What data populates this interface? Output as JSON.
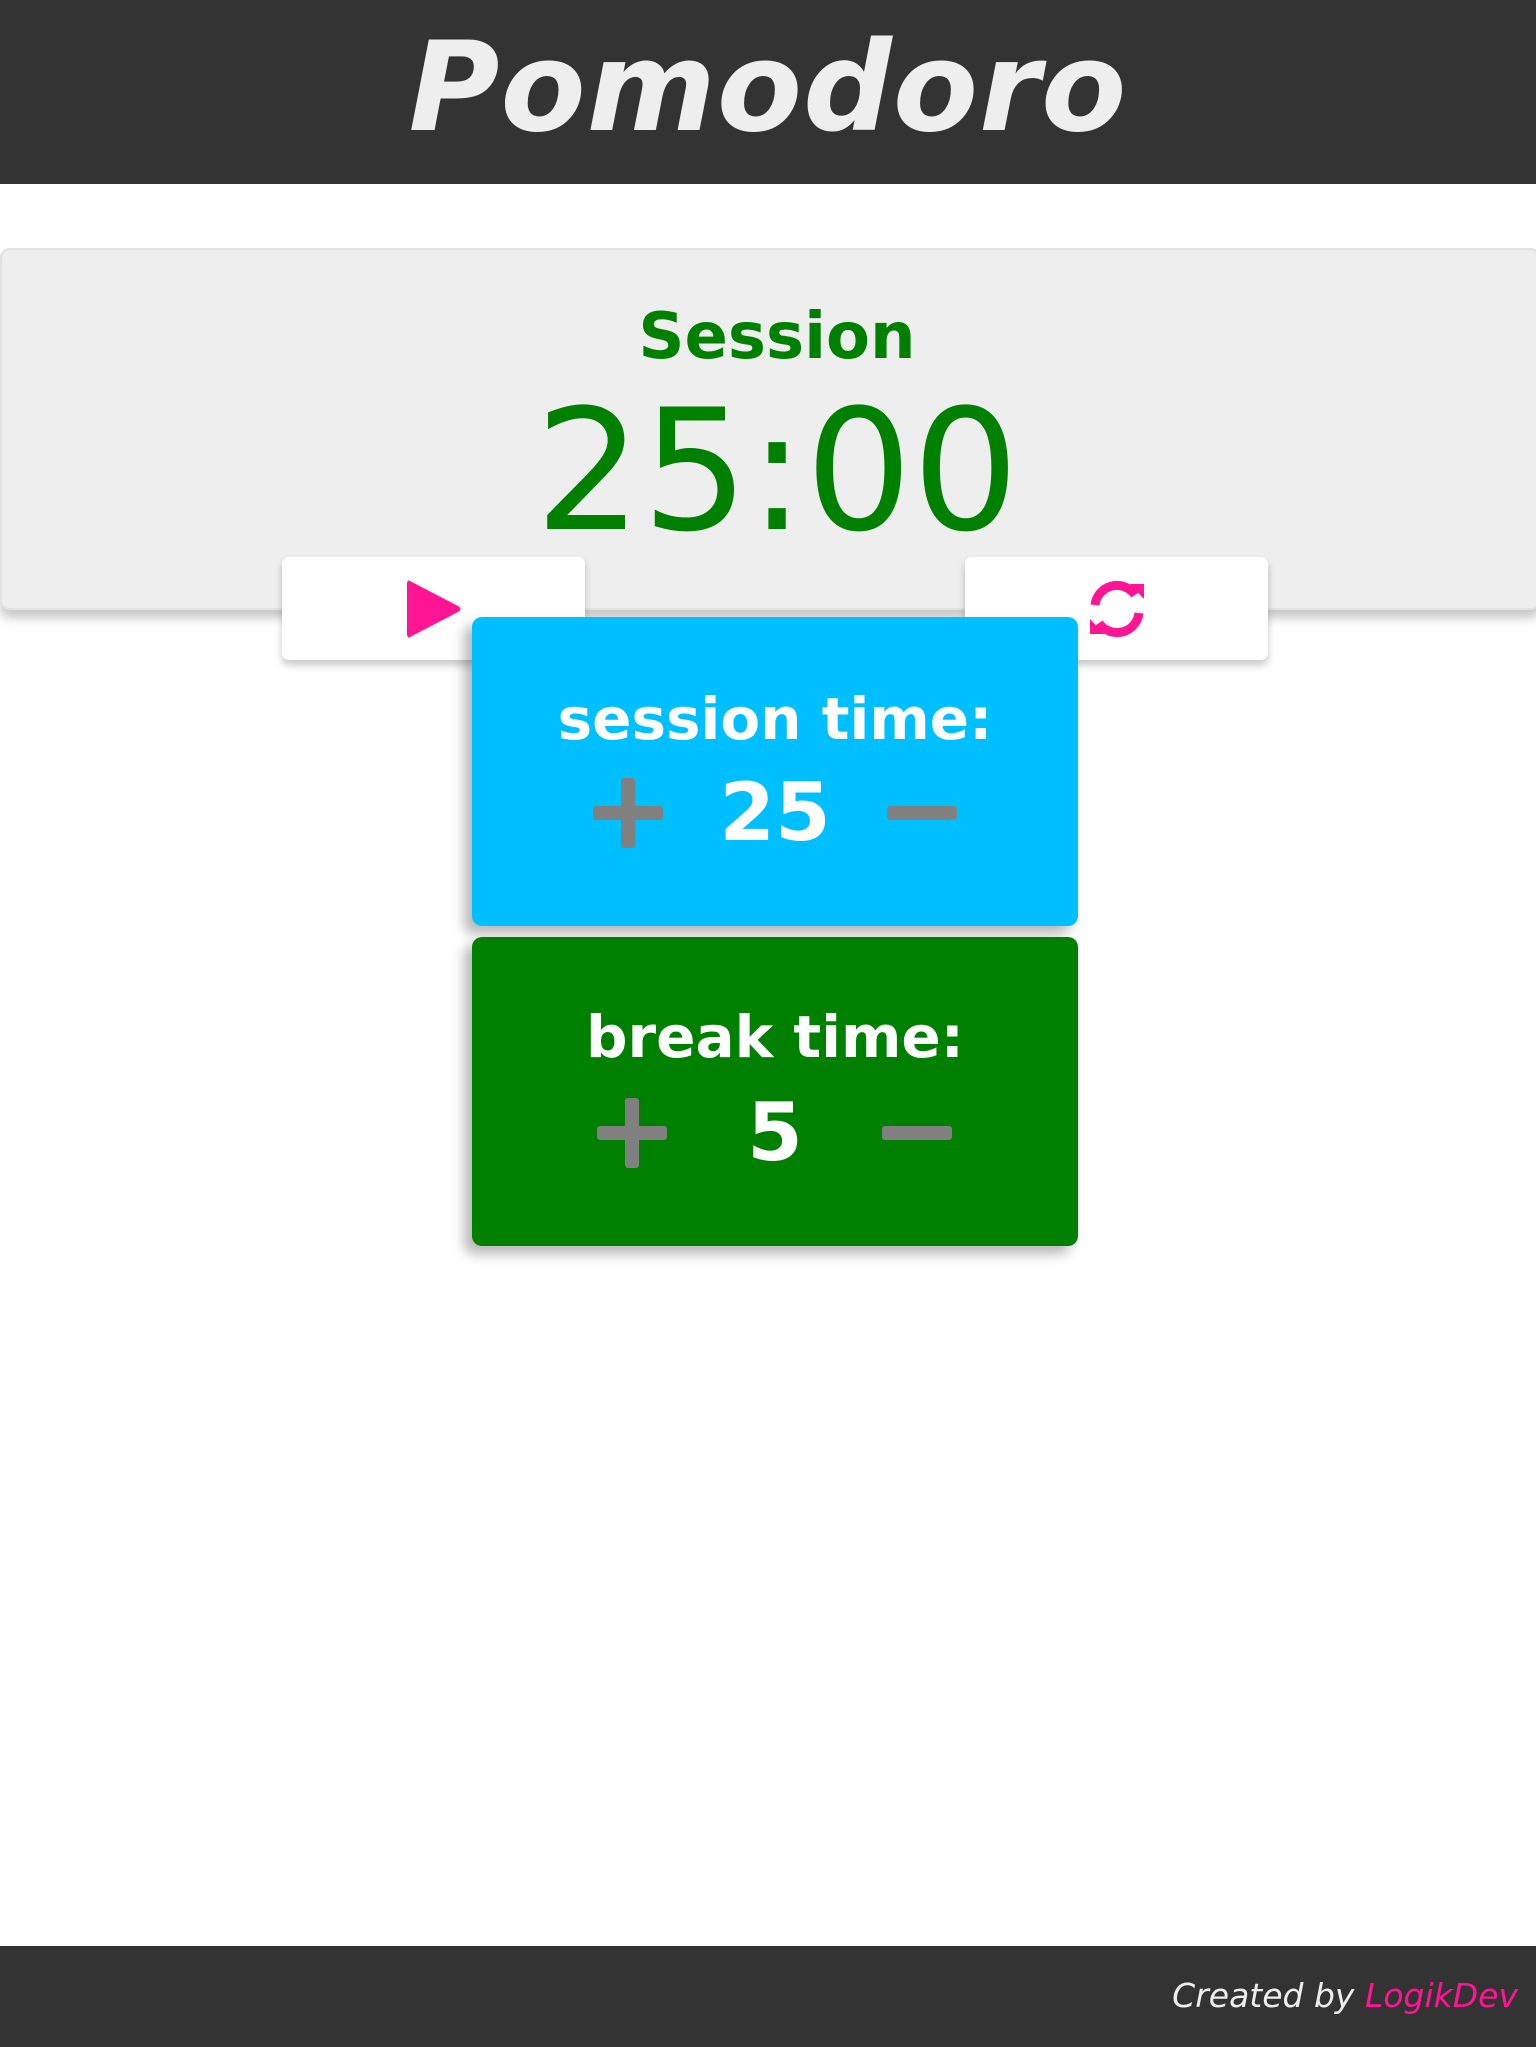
{
  "header": {
    "title": "Pomodoro"
  },
  "timer": {
    "mode_label": "Session",
    "display": "25:00"
  },
  "controls": {
    "play_icon": "play-icon",
    "reset_icon": "refresh-icon",
    "icon_color": "#ff1493"
  },
  "session_setting": {
    "label": "session time:",
    "value": "25",
    "increment_icon": "plus-icon",
    "decrement_icon": "minus-icon",
    "color": "#00bfff"
  },
  "break_setting": {
    "label": "break time:",
    "value": "5",
    "increment_icon": "plus-icon",
    "decrement_icon": "minus-icon",
    "color": "#008000"
  },
  "footer": {
    "credit_prefix": "Created by ",
    "author": "LogikDev"
  },
  "theme": {
    "header_bg": "#333333",
    "timer_color": "#008000",
    "stepper_color": "#808080",
    "accent": "#ff1493"
  }
}
